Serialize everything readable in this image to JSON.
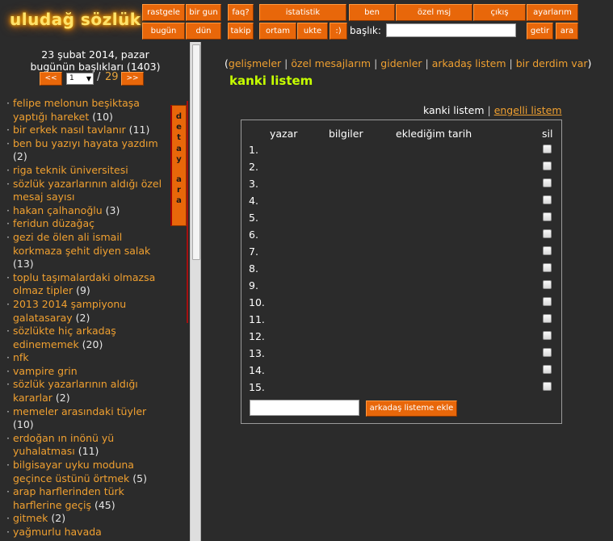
{
  "logo": {
    "text": "uludağ sözlük"
  },
  "header": {
    "row1": [
      "rastgele",
      "bir gun",
      "faq?",
      "istatistik",
      "ben",
      "özel msj",
      "çıkış",
      "ayarlarım"
    ],
    "row2": [
      "bugün",
      "dün",
      "takip",
      "ortam",
      "ukte",
      ":)"
    ],
    "search_label": "başlık:",
    "search_value": "",
    "go_label": "getir",
    "search_button": "ara"
  },
  "left": {
    "date": "23 şubat 2014, pazar",
    "today_label": "bugünün başlıkları (1403)",
    "pager": {
      "prev": "<<",
      "current": "1",
      "separator": "/",
      "total": "29",
      "next": ">>"
    },
    "detay_ara": [
      "d",
      "e",
      "t",
      "a",
      "y",
      "a",
      "r",
      "a"
    ],
    "topics": [
      {
        "title": "felipe melonun beşiktaşa yaptığı hareket",
        "count": "(10)"
      },
      {
        "title": "bir erkek nasıl tavlanır",
        "count": "(11)"
      },
      {
        "title": "ben bu yazıyı hayata yazdım",
        "count": "(2)"
      },
      {
        "title": "riga teknik üniversitesi",
        "count": ""
      },
      {
        "title": "sözlük yazarlarının aldığı özel mesaj sayısı",
        "count": ""
      },
      {
        "title": "hakan çalhanoğlu",
        "count": "(3)"
      },
      {
        "title": "feridun düzağaç",
        "count": ""
      },
      {
        "title": "gezi de ölen ali ismail korkmaza şehit diyen salak",
        "count": "(13)"
      },
      {
        "title": "toplu taşımalardaki olmazsa olmaz tipler",
        "count": "(9)"
      },
      {
        "title": "2013 2014 şampiyonu galatasaray",
        "count": "(2)"
      },
      {
        "title": "sözlükte hiç arkadaş edinememek",
        "count": "(20)"
      },
      {
        "title": "nfk",
        "count": ""
      },
      {
        "title": "vampire grin",
        "count": ""
      },
      {
        "title": "sözlük yazarlarının aldığı kararlar",
        "count": "(2)"
      },
      {
        "title": "memeler arasındaki tüyler",
        "count": "(10)"
      },
      {
        "title": "erdoğan ın inönü yü yuhalatması",
        "count": "(11)"
      },
      {
        "title": "bilgisayar uyku moduna geçince üstünü örtmek",
        "count": "(5)"
      },
      {
        "title": "arap harflerinden türk harflerine geçiş",
        "count": "(45)"
      },
      {
        "title": "gitmek",
        "count": "(2)"
      },
      {
        "title": "yağmurlu havada",
        "count": ""
      }
    ]
  },
  "main": {
    "nav": {
      "open": "(",
      "close": ")",
      "sep": " | ",
      "links": [
        "gelişmeler",
        "özel mesajlarım",
        "gidenler",
        "arkadaş listem",
        "bir derdim var"
      ]
    },
    "title": "kanki listem",
    "tabs": {
      "active": "kanki listem",
      "separator": " | ",
      "other": "engelli listem"
    },
    "table": {
      "headers": {
        "author": "yazar",
        "info": "bilgiler",
        "date": "eklediğim tarih",
        "delete": "sil"
      },
      "rows": [
        "1.",
        "2.",
        "3.",
        "4.",
        "5.",
        "6.",
        "7.",
        "8.",
        "9.",
        "10.",
        "11.",
        "12.",
        "13.",
        "14.",
        "15."
      ]
    },
    "add_input_value": "",
    "add_button": "arkadaş listeme ekle"
  },
  "colors": {
    "accent": "#e8670a",
    "link": "#f0a030",
    "title": "#c6ff00",
    "background": "#2b2b2b"
  }
}
